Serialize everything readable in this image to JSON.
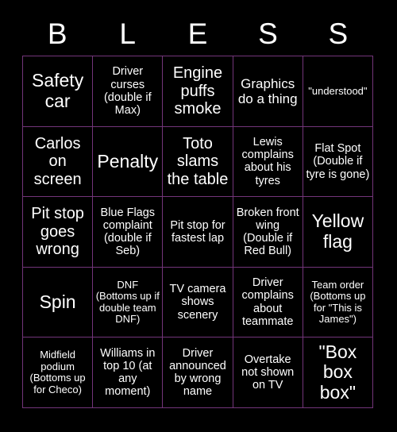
{
  "card": {
    "title_letters": [
      "B",
      "L",
      "E",
      "S",
      "S"
    ],
    "colors": {
      "background": "#000000",
      "border": "#73357a",
      "text": "#ffffff"
    },
    "grid": {
      "columns": 5,
      "rows": 5
    },
    "cells": [
      {
        "text": "Safety car",
        "size": "xl"
      },
      {
        "text": "Driver curses (double if Max)",
        "size": "sm"
      },
      {
        "text": "Engine puffs smoke",
        "size": "lg"
      },
      {
        "text": "Graphics do a thing",
        "size": "md"
      },
      {
        "text": "\"understood\"",
        "size": "xs"
      },
      {
        "text": "Carlos on screen",
        "size": "lg"
      },
      {
        "text": "Penalty",
        "size": "xl"
      },
      {
        "text": "Toto slams the table",
        "size": "lg"
      },
      {
        "text": "Lewis complains about his tyres",
        "size": "sm"
      },
      {
        "text": "Flat Spot (Double if tyre is gone)",
        "size": "sm"
      },
      {
        "text": "Pit stop goes wrong",
        "size": "lg"
      },
      {
        "text": "Blue Flags complaint (double if Seb)",
        "size": "sm"
      },
      {
        "text": "Pit stop for fastest lap",
        "size": "sm"
      },
      {
        "text": "Broken front wing (Double if Red Bull)",
        "size": "sm"
      },
      {
        "text": "Yellow flag",
        "size": "xl"
      },
      {
        "text": "Spin",
        "size": "xl"
      },
      {
        "text": "DNF (Bottoms up if double team DNF)",
        "size": "xs"
      },
      {
        "text": "TV camera shows scenery",
        "size": "sm"
      },
      {
        "text": "Driver complains about teammate",
        "size": "sm"
      },
      {
        "text": "Team order (Bottoms up for \"This is James\")",
        "size": "xs"
      },
      {
        "text": "Midfield podium (Bottoms up for Checo)",
        "size": "xs"
      },
      {
        "text": "Williams in top 10 (at any moment)",
        "size": "sm"
      },
      {
        "text": "Driver announced by wrong name",
        "size": "sm"
      },
      {
        "text": "Overtake not shown on TV",
        "size": "sm"
      },
      {
        "text": "\"Box box box\"",
        "size": "xl"
      }
    ]
  }
}
